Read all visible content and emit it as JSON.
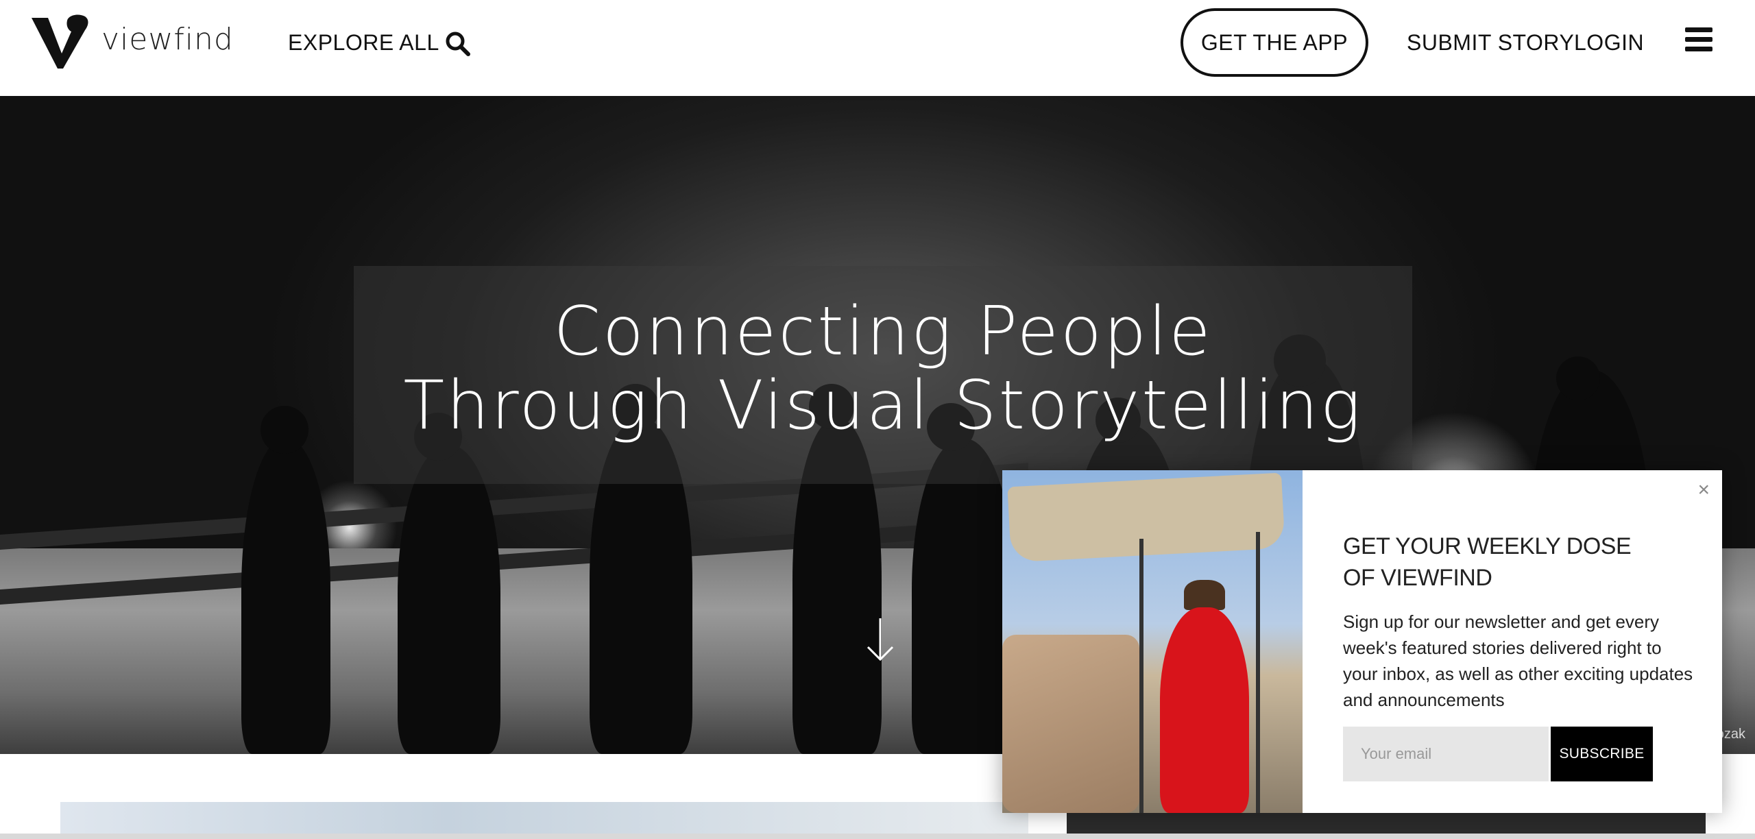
{
  "header": {
    "logo_text": "viewfind",
    "explore_all": "EXPLORE ALL",
    "get_app": "GET THE APP",
    "submit_story": "SUBMIT STORY",
    "login": "LOGIN",
    "icons": [
      "search-icon",
      "menu-icon"
    ]
  },
  "hero": {
    "title_line1": "Connecting People",
    "title_line2": "Through Visual Storytelling",
    "photo_credit": "ozak"
  },
  "popup": {
    "close_label": "×",
    "heading_line1": "GET YOUR WEEKLY DOSE",
    "heading_line2": "OF VIEWFIND",
    "body": "Sign up for our newsletter and get every week's featured stories delivered right to your inbox, as well as other exciting updates and announcements",
    "email_placeholder": "Your email",
    "subscribe_label": "SUBSCRIBE"
  },
  "colors": {
    "text": "#111111",
    "button_bg": "#000000",
    "input_bg": "#e6e6e6"
  }
}
